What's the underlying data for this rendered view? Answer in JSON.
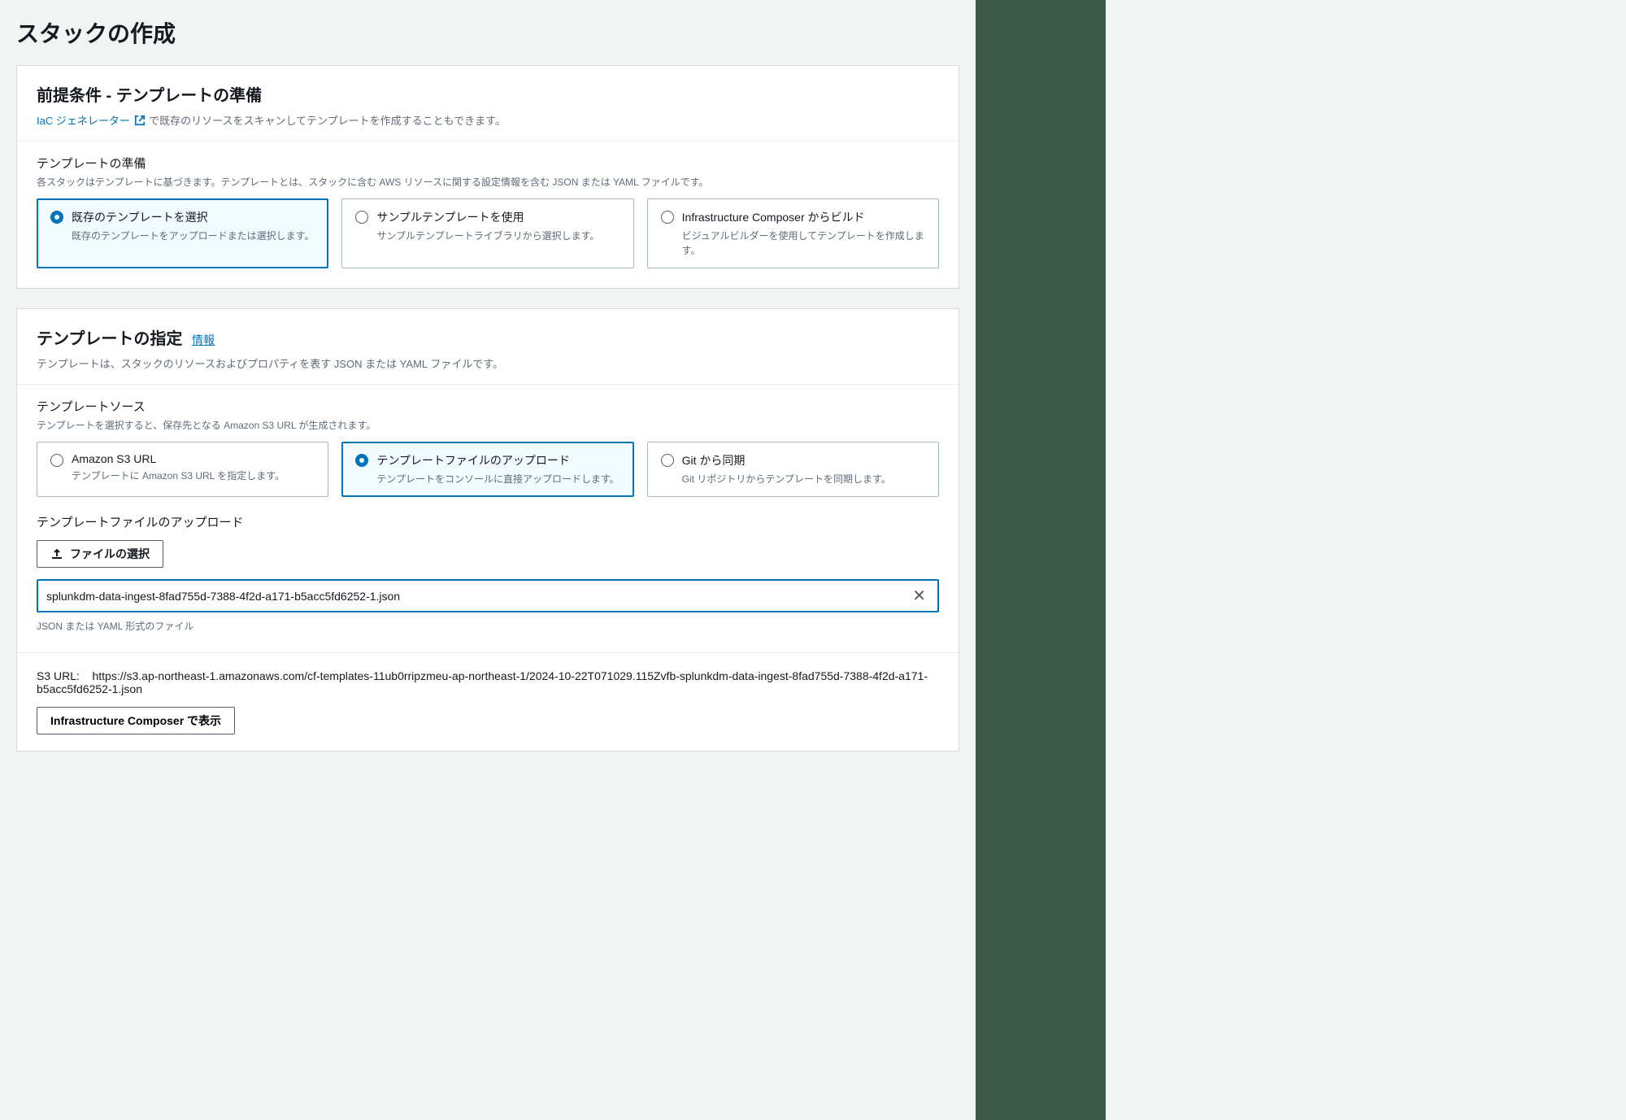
{
  "page": {
    "title": "スタックの作成"
  },
  "prereq": {
    "heading": "前提条件 - テンプレートの準備",
    "link_text": "IaC ジェネレーター",
    "link_suffix": " で既存のリソースをスキャンしてテンプレートを作成することもできます。",
    "template_prep_label": "テンプレートの準備",
    "template_prep_desc": "各スタックはテンプレートに基づきます。テンプレートとは、スタックに含む AWS リソースに関する設定情報を含む JSON または YAML ファイルです。",
    "options": [
      {
        "title": "既存のテンプレートを選択",
        "desc": "既存のテンプレートをアップロードまたは選択します。"
      },
      {
        "title": "サンプルテンプレートを使用",
        "desc": "サンプルテンプレートライブラリから選択します。"
      },
      {
        "title": "Infrastructure Composer からビルド",
        "desc": "ビジュアルビルダーを使用してテンプレートを作成します。"
      }
    ]
  },
  "specify": {
    "heading": "テンプレートの指定",
    "info": "情報",
    "desc": "テンプレートは、スタックのリソースおよびプロパティを表す JSON または YAML ファイルです。",
    "source_label": "テンプレートソース",
    "source_desc": "テンプレートを選択すると、保存先となる Amazon S3 URL が生成されます。",
    "options": [
      {
        "title": "Amazon S3 URL",
        "desc": "テンプレートに Amazon S3 URL を指定します。"
      },
      {
        "title": "テンプレートファイルのアップロード",
        "desc": "テンプレートをコンソールに直接アップロードします。"
      },
      {
        "title": "Git から同期",
        "desc": "Git リポジトリからテンプレートを同期します。"
      }
    ],
    "upload_label": "テンプレートファイルのアップロード",
    "choose_file_btn": "ファイルの選択",
    "filename": "splunkdm-data-ingest-8fad755d-7388-4f2d-a171-b5acc5fd6252-1.json",
    "file_note": "JSON または YAML 形式のファイル",
    "s3_label": "S3 URL:",
    "s3_value": "https://s3.ap-northeast-1.amazonaws.com/cf-templates-11ub0rripzmeu-ap-northeast-1/2024-10-22T071029.115Zvfb-splunkdm-data-ingest-8fad755d-7388-4f2d-a171-b5acc5fd6252-1.json",
    "composer_btn": "Infrastructure Composer で表示"
  }
}
